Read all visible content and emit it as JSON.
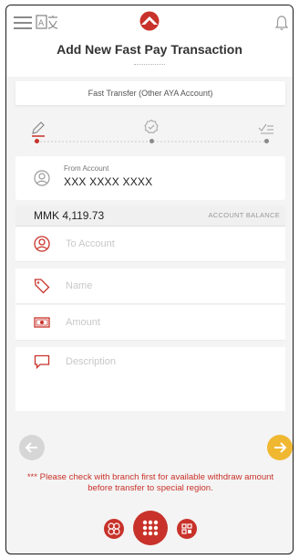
{
  "header": {
    "title": "Add New Fast Pay Transaction",
    "menu_icon": "hamburger-icon",
    "language_icon": "language-toggle-icon",
    "logo_icon": "aya-logo",
    "notification_icon": "bell-icon"
  },
  "transfer_type": "Fast Transfer (Other AYA Account)",
  "steps": [
    {
      "icon": "pencil-icon",
      "active": true
    },
    {
      "icon": "check-badge-icon",
      "active": false
    },
    {
      "icon": "list-check-icon",
      "active": false
    }
  ],
  "from_account": {
    "label": "From Account",
    "value": "XXX XXXX XXXX"
  },
  "balance": {
    "amount": "MMK 4,119.73",
    "label": "ACCOUNT BALANCE"
  },
  "fields": {
    "to_account": "To Account",
    "name": "Name",
    "amount": "Amount",
    "description": "Description"
  },
  "notice": "*** Please check with branch first for available withdraw amount before transfer to special region.",
  "colors": {
    "brand_red": "#c8322a",
    "accent_orange": "#f0b731",
    "disabled_gray": "#d6d6d6"
  }
}
